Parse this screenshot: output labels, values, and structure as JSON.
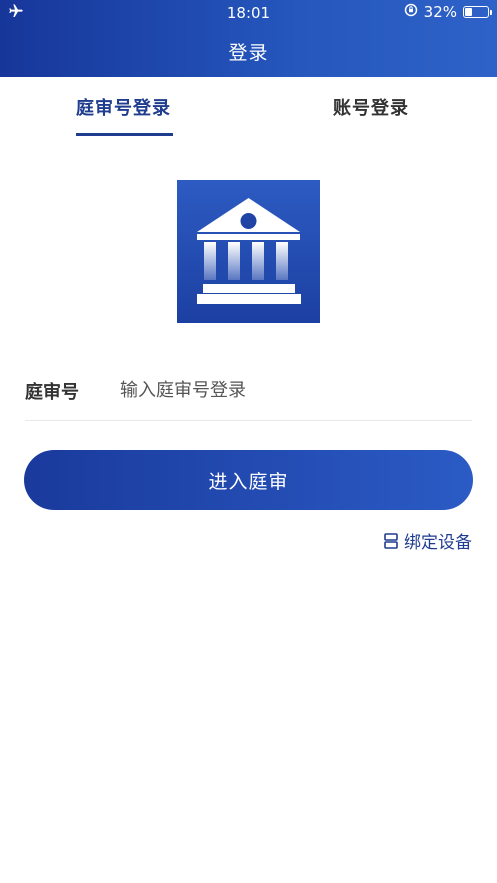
{
  "status_bar": {
    "time": "18:01",
    "battery_percent": "32%",
    "battery_level": 0.32
  },
  "nav": {
    "title": "登录"
  },
  "tabs": [
    {
      "label": "庭审号登录",
      "active": true
    },
    {
      "label": "账号登录",
      "active": false
    }
  ],
  "form": {
    "label": "庭审号",
    "placeholder": "输入庭审号登录",
    "value": ""
  },
  "actions": {
    "enter_label": "进入庭审",
    "bind_label": "绑定设备"
  },
  "colors": {
    "primary": "#1f3c8f",
    "gradient_start": "#17369a",
    "gradient_end": "#2f62c8"
  },
  "icons": [
    "airplane-icon",
    "rotation-lock-icon",
    "battery-icon",
    "courthouse-icon",
    "bind-device-icon"
  ]
}
